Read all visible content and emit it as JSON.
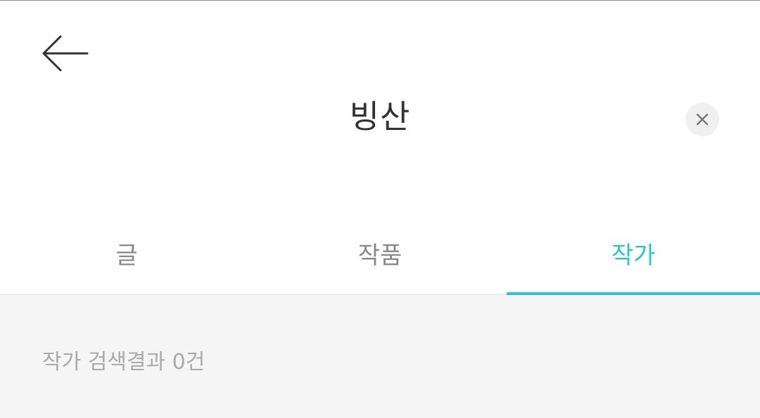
{
  "header": {
    "back_icon": "arrow-left-icon",
    "query": "빙산",
    "clear_icon": "close-icon"
  },
  "tabs": [
    {
      "label": "글",
      "active": false
    },
    {
      "label": "작품",
      "active": false
    },
    {
      "label": "작가",
      "active": true
    }
  ],
  "results": {
    "count_text": "작가 검색결과 0건"
  },
  "colors": {
    "accent": "#2fc4c8",
    "background": "#f5f5f5",
    "text_primary": "#333333",
    "text_muted": "#aaaaaa"
  }
}
